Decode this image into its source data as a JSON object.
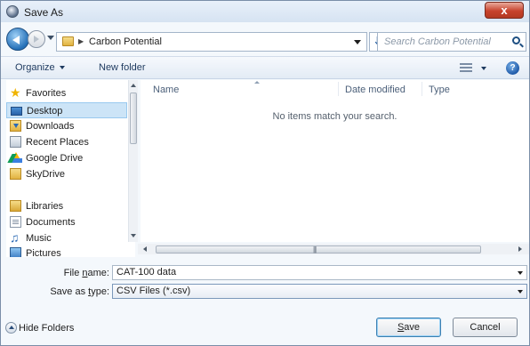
{
  "window": {
    "title": "Save As",
    "close_label": "x"
  },
  "address": {
    "breadcrumb": "Carbon Potential",
    "search_placeholder": "Search Carbon Potential"
  },
  "commands": {
    "organize": "Organize",
    "new_folder": "New folder",
    "help": "?"
  },
  "nav": {
    "favorites_header": "Favorites",
    "items": [
      {
        "label": "Desktop",
        "icon": "desktop-icon",
        "selected": true
      },
      {
        "label": "Downloads",
        "icon": "downloads-icon"
      },
      {
        "label": "Recent Places",
        "icon": "recent-places-icon"
      },
      {
        "label": "Google Drive",
        "icon": "google-drive-icon"
      },
      {
        "label": "SkyDrive",
        "icon": "skydrive-icon"
      }
    ],
    "libraries_header": "Libraries",
    "library_items": [
      {
        "label": "Documents",
        "icon": "documents-icon"
      },
      {
        "label": "Music",
        "icon": "music-icon"
      },
      {
        "label": "Pictures",
        "icon": "pictures-icon"
      }
    ]
  },
  "filelist": {
    "columns": [
      "Name",
      "Date modified",
      "Type"
    ],
    "empty_message": "No items match your search."
  },
  "fields": {
    "file_name_label_prefix": "File ",
    "file_name_label_underlined": "n",
    "file_name_label_suffix": "ame:",
    "file_name_value": "CAT-100 data",
    "save_type_label_prefix": "Save as ",
    "save_type_label_underlined": "t",
    "save_type_label_suffix": "ype:",
    "save_type_value": "CSV Files (*.csv)"
  },
  "footer": {
    "hide_folders": "Hide Folders",
    "save_underlined": "S",
    "save_rest": "ave",
    "cancel": "Cancel"
  }
}
